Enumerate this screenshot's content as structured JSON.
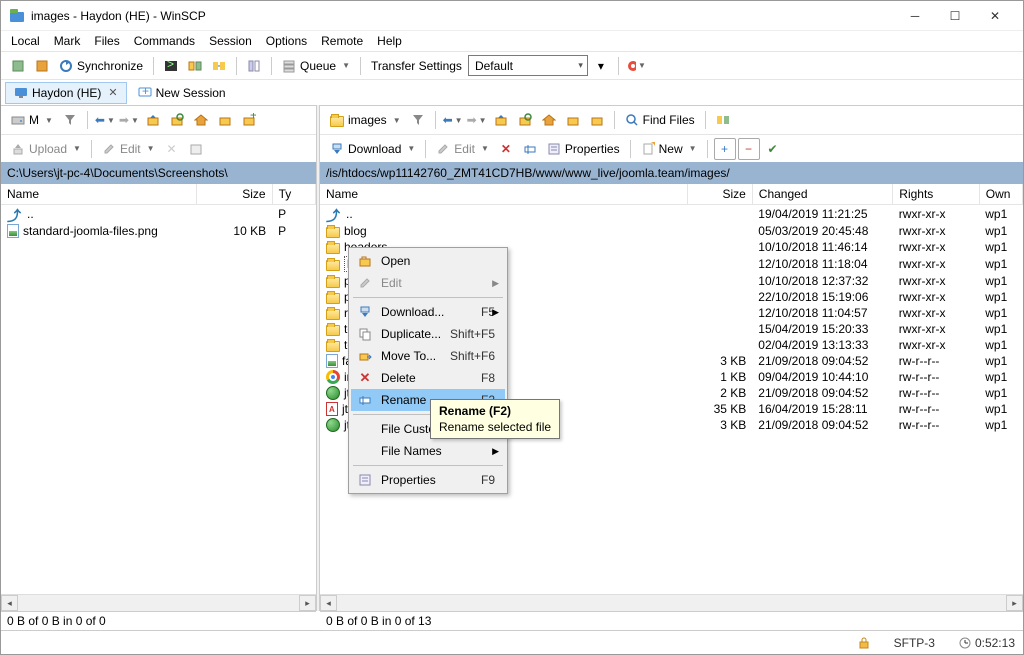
{
  "window": {
    "title": "images - Haydon (HE) - WinSCP"
  },
  "menu": [
    "Local",
    "Mark",
    "Files",
    "Commands",
    "Session",
    "Options",
    "Remote",
    "Help"
  ],
  "toolbar_main": {
    "sync_label": "Synchronize",
    "queue_label": "Queue",
    "ts_label": "Transfer Settings",
    "ts_value": "Default"
  },
  "sessions": {
    "active": "Haydon (HE)",
    "new": "New Session"
  },
  "nav_left": {
    "drive": "M"
  },
  "nav_right": {
    "folder": "images",
    "find": "Find Files"
  },
  "action_left": {
    "upload": "Upload",
    "edit": "Edit"
  },
  "action_right": {
    "download": "Download",
    "edit": "Edit",
    "props": "Properties",
    "new": "New"
  },
  "left": {
    "path": "C:\\Users\\jt-pc-4\\Documents\\Screenshots\\",
    "cols": [
      "Name",
      "Size",
      "Ty"
    ],
    "rows": [
      {
        "icon": "up",
        "name": "..",
        "size": "",
        "type": "P"
      },
      {
        "icon": "png",
        "name": "standard-joomla-files.png",
        "size": "10 KB",
        "type": "P"
      }
    ],
    "status": "0 B of 0 B in 0 of 0"
  },
  "right": {
    "path": "/is/htdocs/wp11142760_ZMT41CD7HB/www/www_live/joomla.team/images/",
    "cols": [
      "Name",
      "Size",
      "Changed",
      "Rights",
      "Own"
    ],
    "rows": [
      {
        "icon": "up",
        "name": "..",
        "size": "",
        "changed": "19/04/2019 11:21:25",
        "rights": "rwxr-xr-x",
        "own": "wp1"
      },
      {
        "icon": "folder",
        "name": "blog",
        "size": "",
        "changed": "05/03/2019 20:45:48",
        "rights": "rwxr-xr-x",
        "own": "wp1"
      },
      {
        "icon": "folder",
        "name": "headers",
        "size": "",
        "changed": "10/10/2018 11:46:14",
        "rights": "rwxr-xr-x",
        "own": "wp1"
      },
      {
        "icon": "folder",
        "name": "lo",
        "renaming": true,
        "size": "",
        "changed": "12/10/2018 11:18:04",
        "rights": "rwxr-xr-x",
        "own": "wp1"
      },
      {
        "icon": "folder",
        "name": "p",
        "size": "",
        "changed": "10/10/2018 12:37:32",
        "rights": "rwxr-xr-x",
        "own": "wp1"
      },
      {
        "icon": "folder",
        "name": "p",
        "size": "",
        "changed": "22/10/2018 15:19:06",
        "rights": "rwxr-xr-x",
        "own": "wp1"
      },
      {
        "icon": "folder",
        "name": "re",
        "size": "",
        "changed": "12/10/2018 11:04:57",
        "rights": "rwxr-xr-x",
        "own": "wp1"
      },
      {
        "icon": "folder",
        "name": "te",
        "size": "",
        "changed": "15/04/2019 15:20:33",
        "rights": "rwxr-xr-x",
        "own": "wp1"
      },
      {
        "icon": "folder",
        "name": "te",
        "size": "",
        "changed": "02/04/2019 13:13:33",
        "rights": "rwxr-xr-x",
        "own": "wp1"
      },
      {
        "icon": "png",
        "name": "fa",
        "size": "3 KB",
        "changed": "21/09/2018 09:04:52",
        "rights": "rw-r--r--",
        "own": "wp1"
      },
      {
        "icon": "chrome",
        "name": "in",
        "size": "1 KB",
        "changed": "09/04/2019 10:44:10",
        "rights": "rw-r--r--",
        "own": "wp1"
      },
      {
        "icon": "html",
        "name": "jt",
        "size": "2 KB",
        "changed": "21/09/2018 09:04:52",
        "rights": "rw-r--r--",
        "own": "wp1"
      },
      {
        "icon": "pdf",
        "name": "jt",
        "size": "35 KB",
        "changed": "16/04/2019 15:28:11",
        "rights": "rw-r--r--",
        "own": "wp1"
      },
      {
        "icon": "html",
        "name": "jt",
        "size": "3 KB",
        "changed": "21/09/2018 09:04:52",
        "rights": "rw-r--r--",
        "own": "wp1"
      }
    ],
    "status": "0 B of 0 B in 0 of 13"
  },
  "context_menu": {
    "items": [
      {
        "icon": "open",
        "label": "Open",
        "shortcut": "",
        "sub": false
      },
      {
        "icon": "edit",
        "label": "Edit",
        "shortcut": "",
        "sub": true,
        "disabled": true
      },
      {
        "sep": true
      },
      {
        "icon": "download",
        "label": "Download...",
        "shortcut": "F5",
        "sub": true
      },
      {
        "icon": "duplicate",
        "label": "Duplicate...",
        "shortcut": "Shift+F5"
      },
      {
        "icon": "moveto",
        "label": "Move To...",
        "shortcut": "Shift+F6"
      },
      {
        "icon": "delete",
        "label": "Delete",
        "shortcut": "F8"
      },
      {
        "icon": "rename",
        "label": "Rename",
        "shortcut": "F2",
        "hl": true
      },
      {
        "sep": true
      },
      {
        "icon": "",
        "label": "File Custom",
        "shortcut": "",
        "sub": true
      },
      {
        "icon": "",
        "label": "File Names",
        "shortcut": "",
        "sub": true
      },
      {
        "sep": true
      },
      {
        "icon": "props",
        "label": "Properties",
        "shortcut": "F9"
      }
    ]
  },
  "tooltip": {
    "title": "Rename (F2)",
    "body": "Rename selected file"
  },
  "statusbar": {
    "protocol": "SFTP-3",
    "time": "0:52:13"
  }
}
